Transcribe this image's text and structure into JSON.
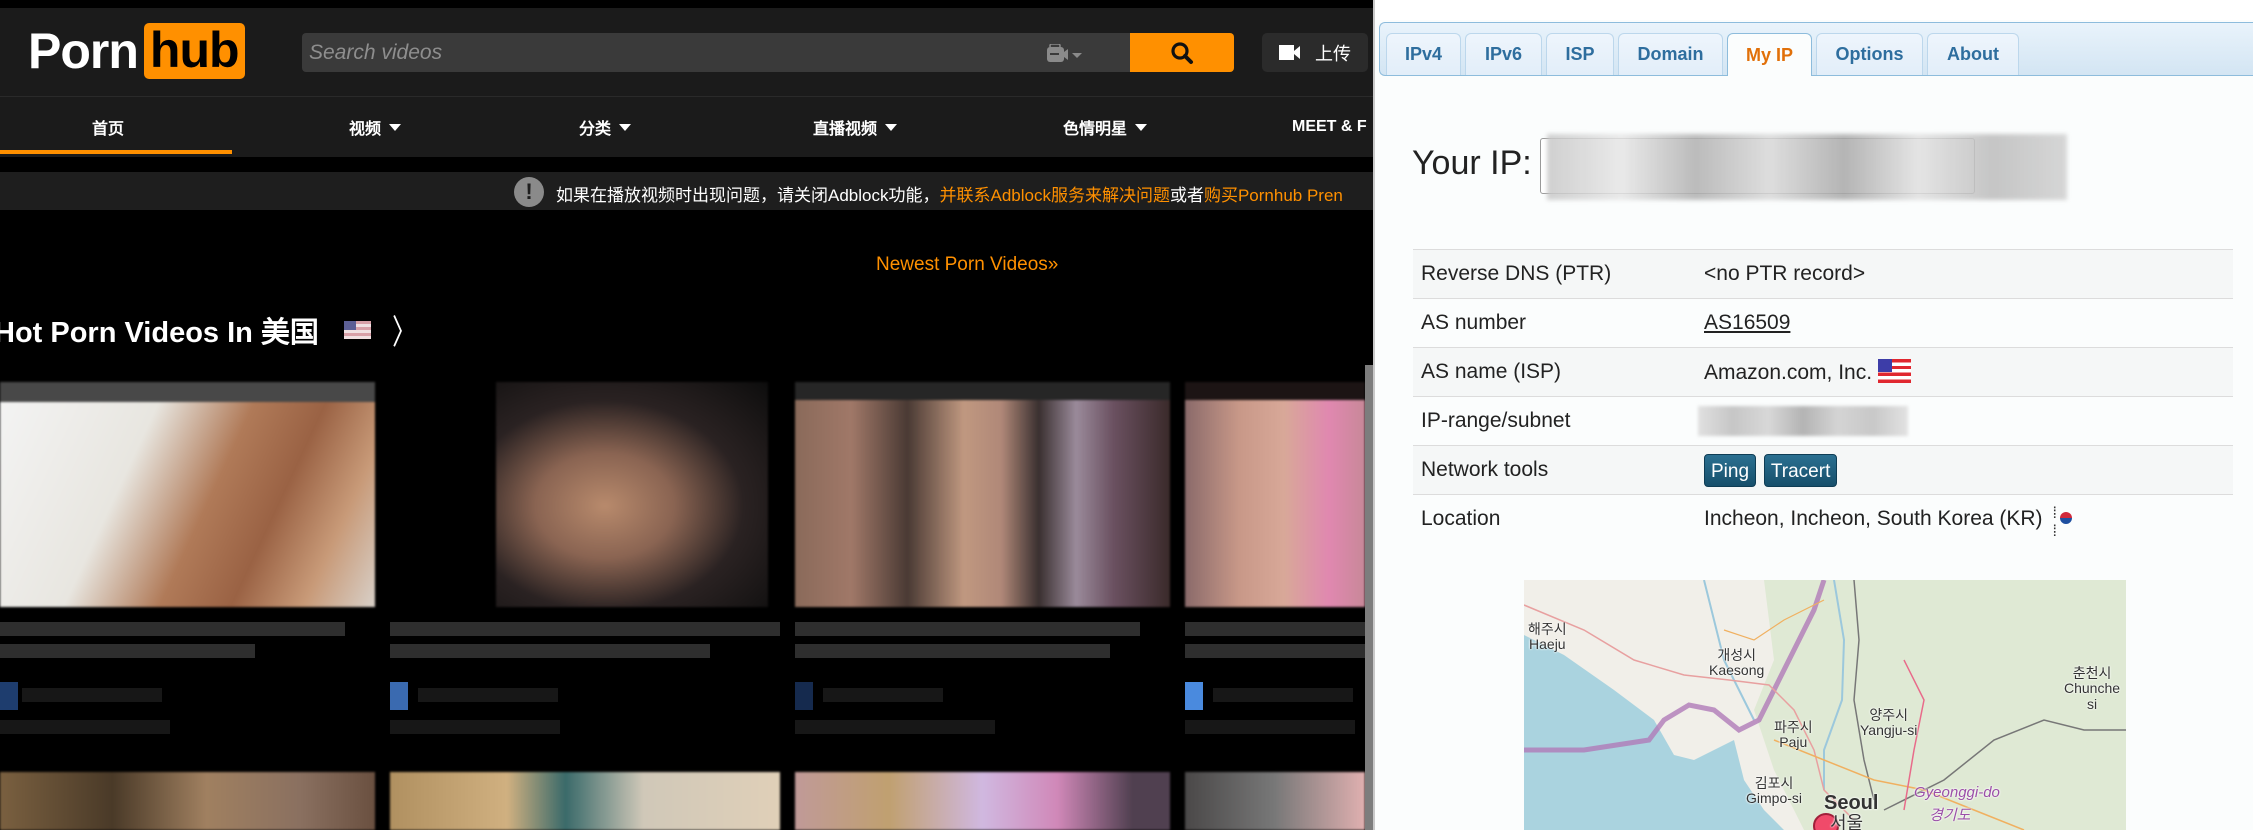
{
  "site": {
    "logo": {
      "word": "Porn",
      "boxed": "hub"
    },
    "search": {
      "placeholder": "Search videos",
      "value": ""
    },
    "upload_label": "上传",
    "nav": [
      {
        "label": "首页",
        "active": true,
        "dropdown": false
      },
      {
        "label": "视频",
        "active": false,
        "dropdown": true
      },
      {
        "label": "分类",
        "active": false,
        "dropdown": true
      },
      {
        "label": "直播视频",
        "active": false,
        "dropdown": true
      },
      {
        "label": "色情明星",
        "active": false,
        "dropdown": true
      },
      {
        "label": "MEET & F",
        "active": false,
        "dropdown": false
      }
    ],
    "notice": {
      "part1": "如果在播放视频时出现问题，请关闭Adblock功能，",
      "link1": "并联系Adblock服务来解决问题",
      "part2": "或者",
      "link2": "购买Pornhub Pren"
    },
    "newest_link": "Newest Porn Videos»",
    "section_title": "Hot Porn Videos In 美国",
    "section_flag": "us-flag",
    "videos_note": "thumbnails and titles are obscured (pixelated) in the screenshot",
    "accent_color": "#ff9000"
  },
  "ip_tool": {
    "tabs": [
      {
        "label": "IPv4",
        "active": false
      },
      {
        "label": "IPv6",
        "active": false
      },
      {
        "label": "ISP",
        "active": false
      },
      {
        "label": "Domain",
        "active": false
      },
      {
        "label": "My IP",
        "active": true
      },
      {
        "label": "Options",
        "active": false
      },
      {
        "label": "About",
        "active": false
      }
    ],
    "your_ip_label": "Your IP:",
    "your_ip_value": "[obscured]",
    "rows": {
      "ptr": {
        "label": "Reverse DNS (PTR)",
        "value": "<no PTR record>"
      },
      "asn": {
        "label": "AS number",
        "value": "AS16509"
      },
      "asname": {
        "label": "AS name (ISP)",
        "value": "Amazon.com, Inc."
      },
      "range": {
        "label": "IP-range/subnet",
        "value": "[obscured]"
      },
      "tools": {
        "label": "Network tools",
        "ping": "Ping",
        "tracert": "Tracert"
      },
      "location": {
        "label": "Location",
        "value": "Incheon, Incheon, South Korea (KR)"
      }
    },
    "map": {
      "labels": {
        "haeju": "해주시\nHaeju",
        "kaesong": "개성시\nKaesong",
        "paju": "파주시\nPaju",
        "yangju": "양주시\nYangju-si",
        "chuncheon": "춘천시\nChunche\nsi",
        "gimpo": "김포시\nGimpo-si",
        "seoul": "Seoul",
        "seoul_ko": "서울",
        "gyeonggi": "Gyeonggi-do",
        "gyeonggi_ko": "경기도"
      }
    },
    "active_tab_color": "#e17009",
    "tab_text_color": "#2e6e9e"
  }
}
